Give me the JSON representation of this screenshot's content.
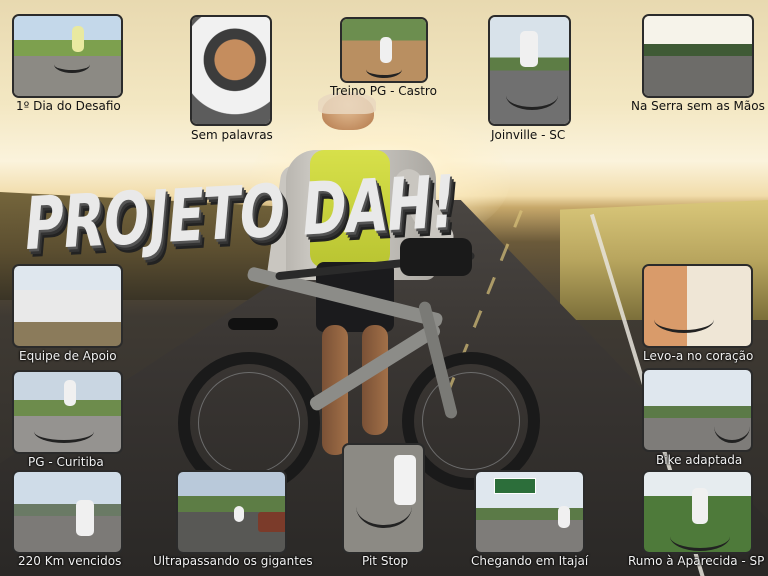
{
  "title": "PROJETO DAH!",
  "thumbnails": [
    {
      "caption": "1º Dia do Desafio"
    },
    {
      "caption": "Sem palavras"
    },
    {
      "caption": "Treino PG - Castro"
    },
    {
      "caption": "Joinville - SC"
    },
    {
      "caption": "Na Serra sem as Mãos"
    },
    {
      "caption": "Equipe de Apoio"
    },
    {
      "caption": "Levo-a no coração"
    },
    {
      "caption": "PG - Curitiba"
    },
    {
      "caption": "Bike adaptada"
    },
    {
      "caption": "220 Km vencidos"
    },
    {
      "caption": "Ultrapassando os gigantes"
    },
    {
      "caption": "Pit Stop"
    },
    {
      "caption": "Chegando em Itajaí"
    },
    {
      "caption": "Rumo à Aparecida - SP"
    }
  ]
}
